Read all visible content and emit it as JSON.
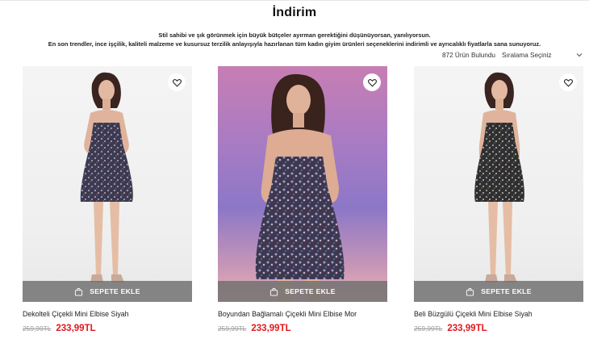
{
  "page": {
    "title": "İndirim",
    "intro_line1": "Stil sahibi ve şık görünmek için büyük bütçeler ayırman gerektiğini düşünüyorsan, yanılıyorsun.",
    "intro_line2": "En son trendler, ince işçilik, kaliteli malzeme ve kusursuz terzilik anlayışıyla hazırlanan tüm kadın giyim ürünleri seçeneklerini indirimli ve ayrıcalıklı fiyatlarla sana sunuyoruz."
  },
  "toolbar": {
    "product_count": "872 Ürün Bulundu",
    "sort_label": "Sıralama Seçiniz",
    "sort_icon": "chevron-down-icon"
  },
  "products": [
    {
      "name": "Dekolteli Çiçekli Mini Elbise Siyah",
      "old_price": "259,99TL",
      "price": "233,99TL",
      "add_to_cart": "SEPETE EKLE",
      "background": "light"
    },
    {
      "name": "Boyundan Bağlamalı Çiçekli Mini Elbise Mor",
      "old_price": "259,99TL",
      "price": "233,99TL",
      "add_to_cart": "SEPETE EKLE",
      "background": "purple"
    },
    {
      "name": "Beli Büzgülü Çiçekli Mini Elbise Siyah",
      "old_price": "259,99TL",
      "price": "233,99TL",
      "add_to_cart": "SEPETE EKLE",
      "background": "light"
    }
  ],
  "colors": {
    "sale_price": "#e0191e",
    "old_price": "#9a9a9a",
    "cart_button_bg": "#6e6e6e"
  }
}
